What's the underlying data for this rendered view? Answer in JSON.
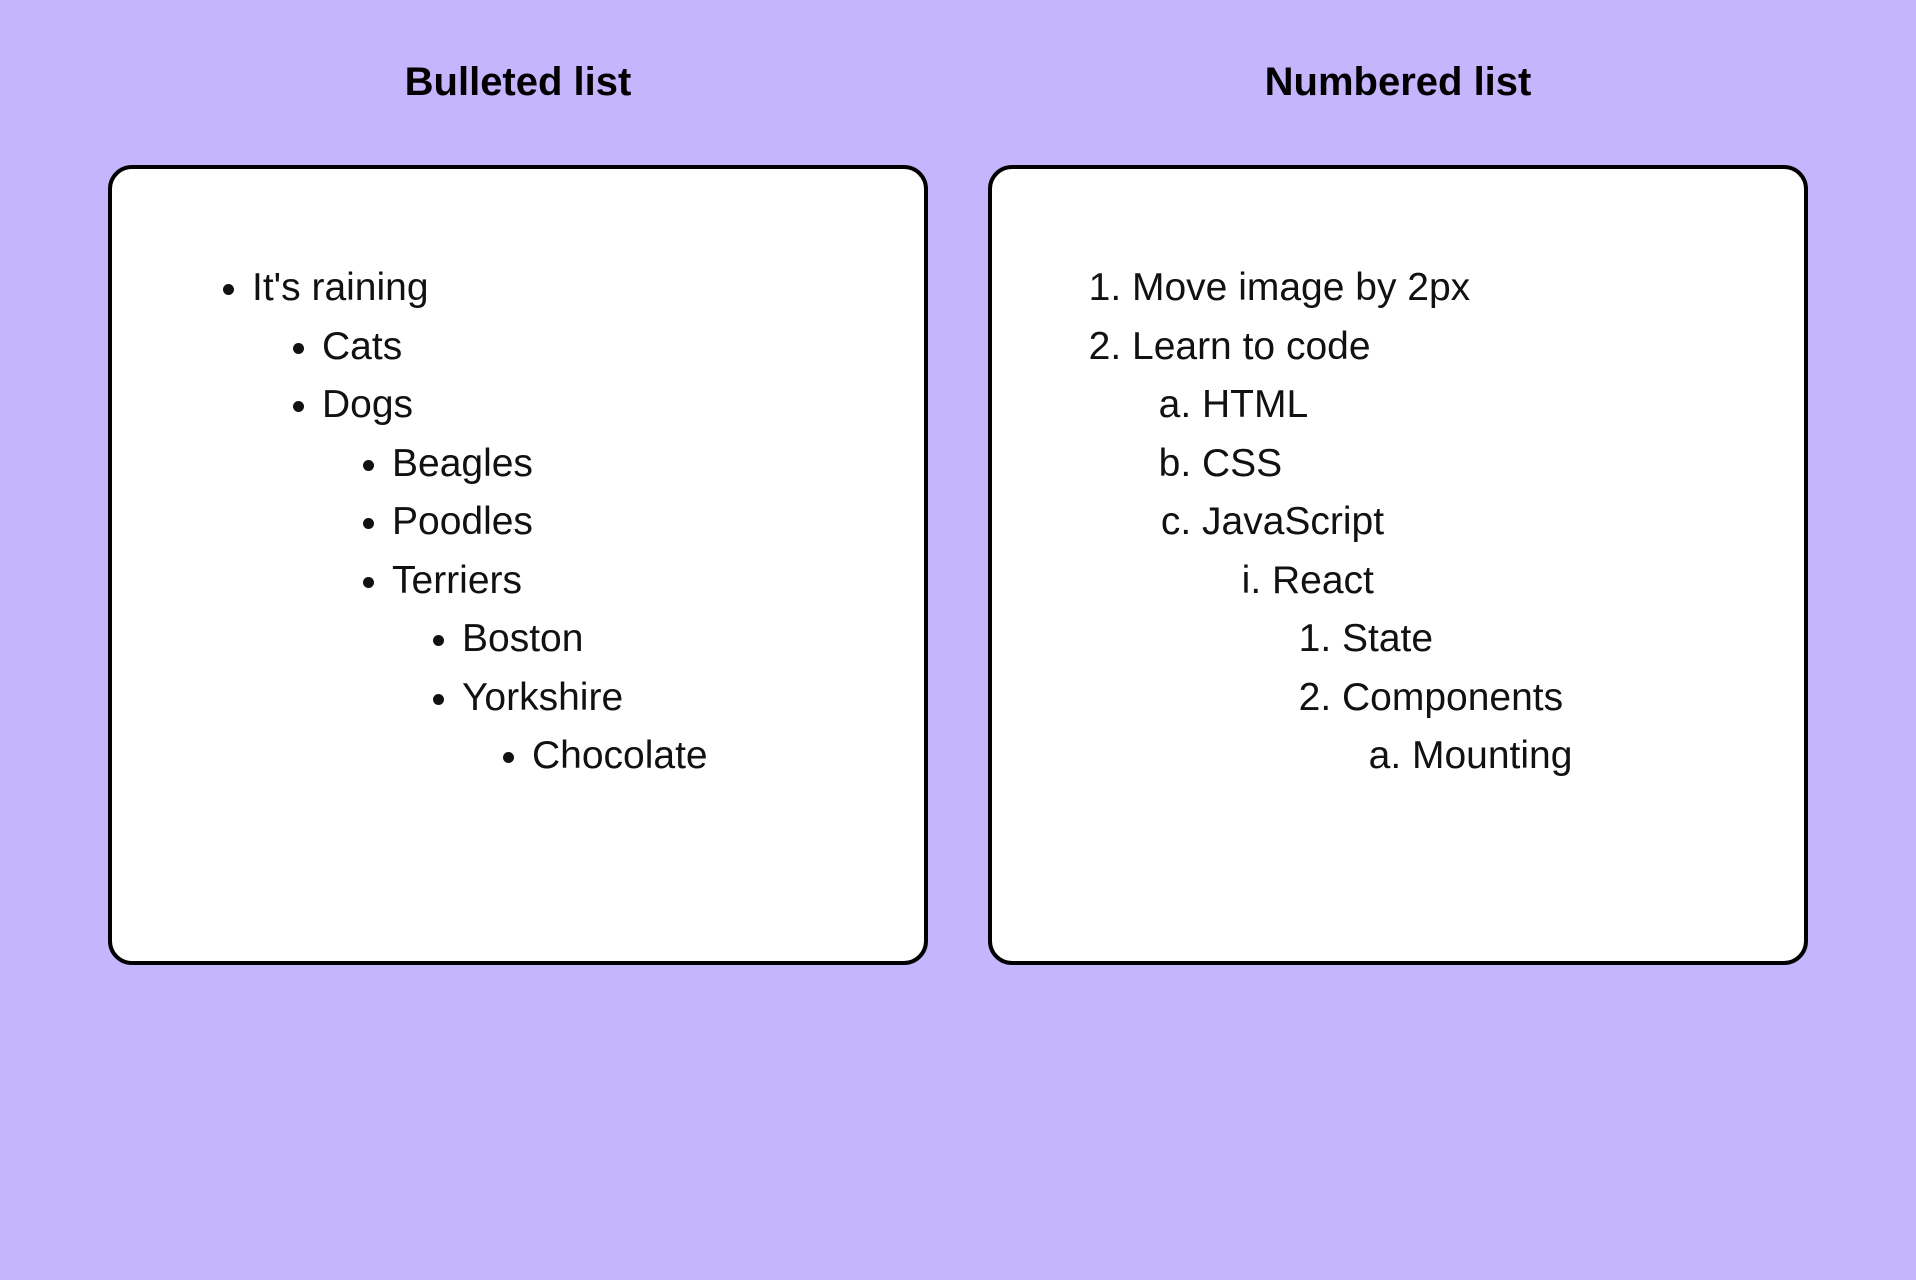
{
  "bulleted": {
    "title": "Bulleted list",
    "items": [
      "It's raining",
      "Cats",
      "Dogs",
      "Beagles",
      "Poodles",
      "Terriers",
      "Boston",
      "Yorkshire",
      "Chocolate"
    ]
  },
  "numbered": {
    "title": "Numbered list",
    "items": [
      "Move image by 2px",
      "Learn to code",
      "HTML",
      "CSS",
      "JavaScript",
      "React",
      "State",
      "Components",
      "Mounting"
    ]
  }
}
